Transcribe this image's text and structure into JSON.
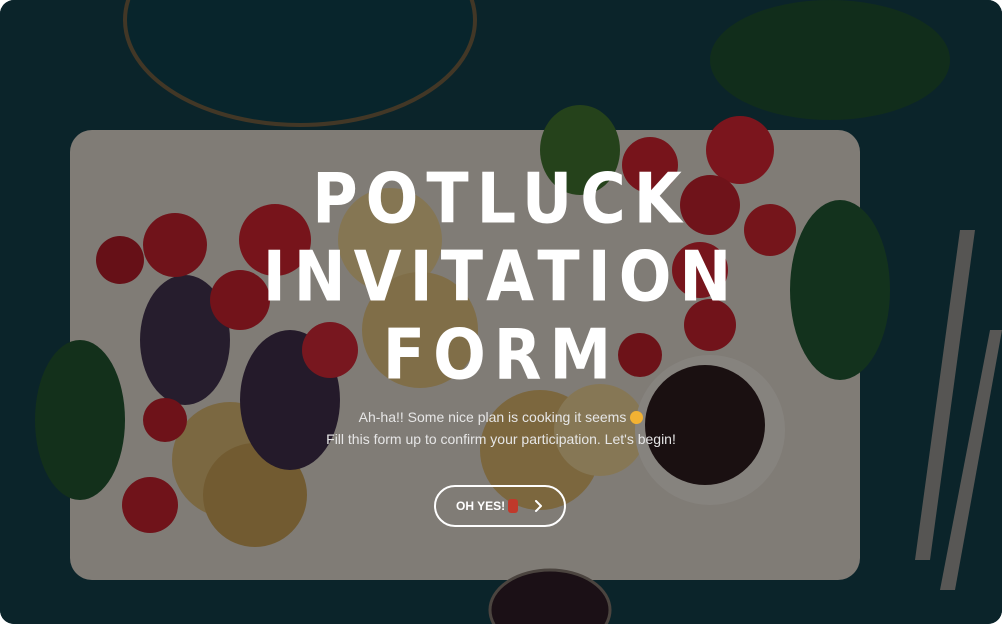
{
  "hero": {
    "title_line1": "POTLUCK",
    "title_line2": "INVITATION",
    "title_line3": "FORM",
    "subtitle_line1": "Ah-ha!! Some nice plan is cooking it seems",
    "subtitle_line2": "Fill this form up to confirm your participation. Let's begin!",
    "subtitle_emoji": "smiling-face-emoji"
  },
  "cta": {
    "label": "OH YES!",
    "emoji": "dancer-emoji",
    "icon": "chevron-right-icon"
  },
  "colors": {
    "background": "#0f2a33",
    "text": "#ffffff",
    "button_border": "#ffffff"
  }
}
